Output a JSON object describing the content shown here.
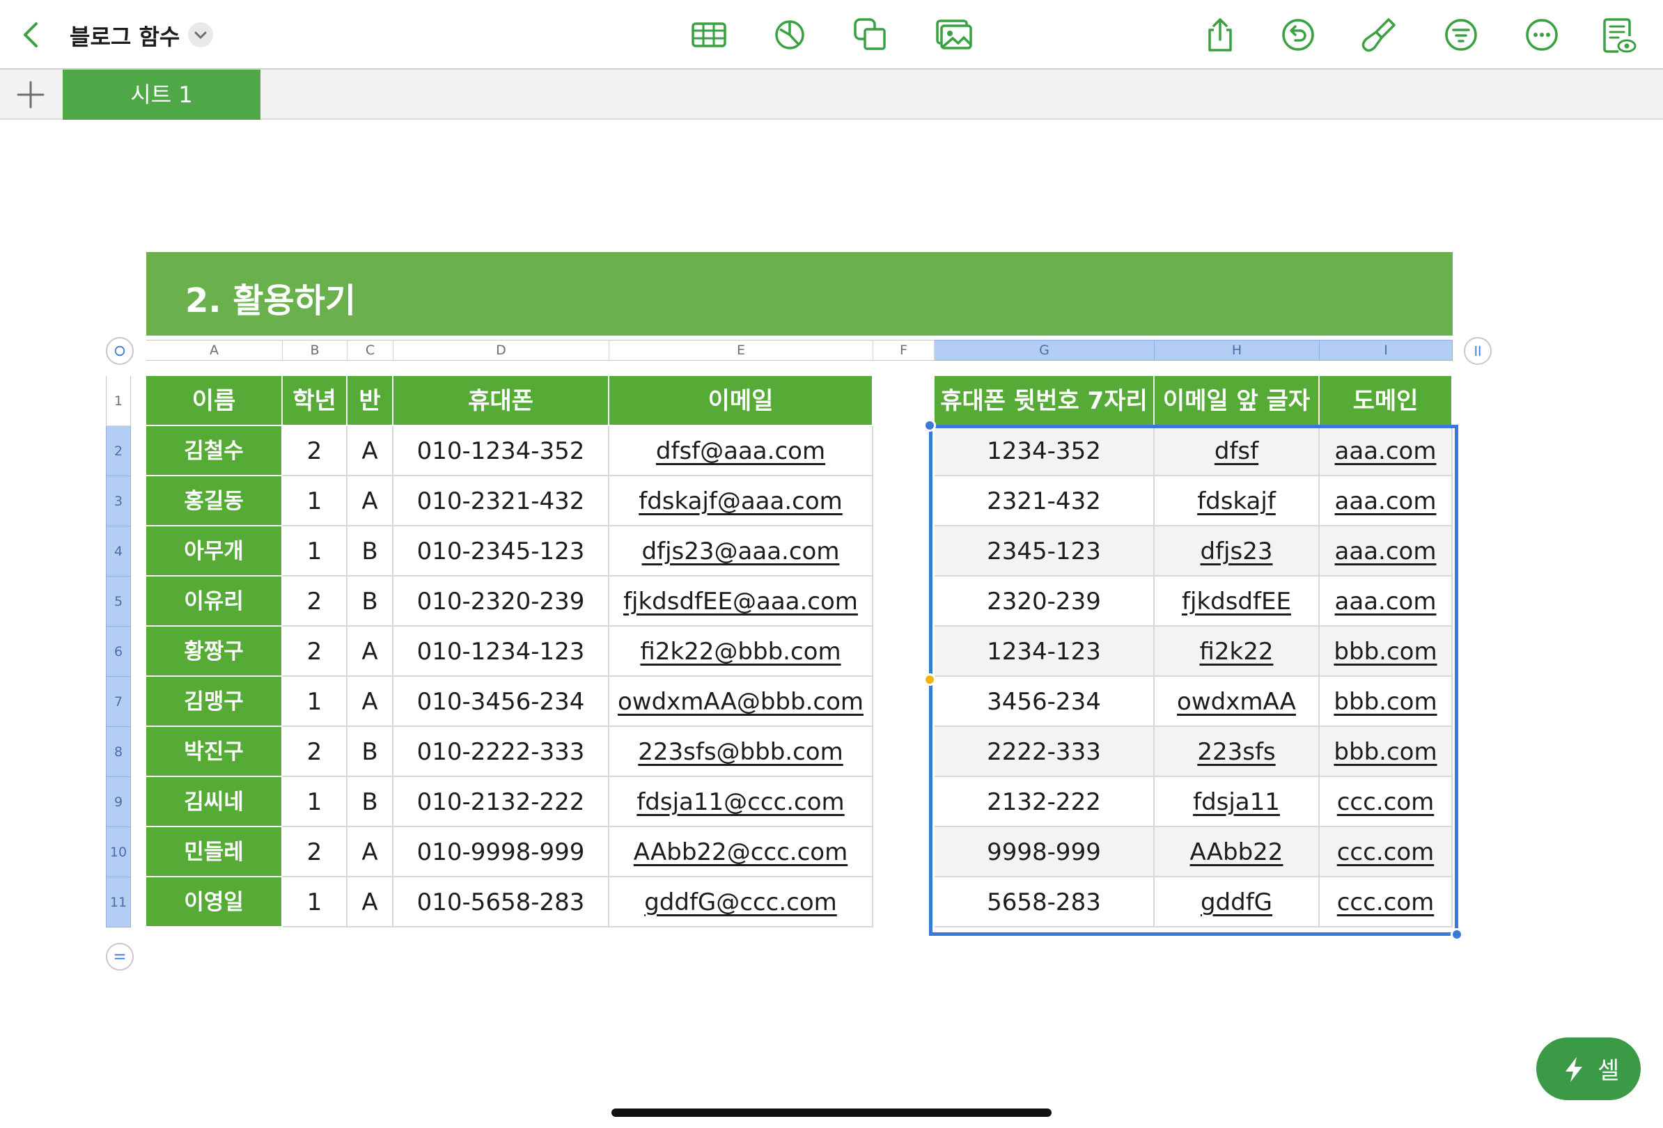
{
  "toolbar": {
    "title": "블로그 함수",
    "icons": [
      "back-chevron-icon",
      "table-icon",
      "chart-icon",
      "shapes-icon",
      "media-icon",
      "share-icon",
      "undo-icon",
      "format-brush-icon",
      "organize-icon",
      "more-icon",
      "document-view-icon"
    ]
  },
  "tabs": {
    "sheet1": "시트 1"
  },
  "table": {
    "title": "2. 활용하기",
    "columns": [
      "A",
      "B",
      "C",
      "D",
      "E",
      "F",
      "G",
      "H",
      "I"
    ],
    "headers": {
      "name": "이름",
      "grade": "학년",
      "class": "반",
      "phone": "휴대폰",
      "email": "이메일",
      "phone7": "휴대폰 뒷번호 7자리",
      "emailPrefix": "이메일 앞 글자",
      "domain": "도메인"
    },
    "rows": [
      {
        "num": "2",
        "name": "김철수",
        "grade": "2",
        "cls": "A",
        "phone": "010-1234-352",
        "email": "dfsf@aaa.com",
        "p7": "1234-352",
        "prefix": "dfsf",
        "domain": "aaa.com"
      },
      {
        "num": "3",
        "name": "홍길동",
        "grade": "1",
        "cls": "A",
        "phone": "010-2321-432",
        "email": "fdskajf@aaa.com",
        "p7": "2321-432",
        "prefix": "fdskajf",
        "domain": "aaa.com"
      },
      {
        "num": "4",
        "name": "아무개",
        "grade": "1",
        "cls": "B",
        "phone": "010-2345-123",
        "email": "dfjs23@aaa.com",
        "p7": "2345-123",
        "prefix": "dfjs23",
        "domain": "aaa.com"
      },
      {
        "num": "5",
        "name": "이유리",
        "grade": "2",
        "cls": "B",
        "phone": "010-2320-239",
        "email": "fjkdsdfEE@aaa.com",
        "p7": "2320-239",
        "prefix": "fjkdsdfEE",
        "domain": "aaa.com"
      },
      {
        "num": "6",
        "name": "황짱구",
        "grade": "2",
        "cls": "A",
        "phone": "010-1234-123",
        "email": "fi2k22@bbb.com",
        "p7": "1234-123",
        "prefix": "fi2k22",
        "domain": "bbb.com"
      },
      {
        "num": "7",
        "name": "김맹구",
        "grade": "1",
        "cls": "A",
        "phone": "010-3456-234",
        "email": "owdxmAA@bbb.com",
        "p7": "3456-234",
        "prefix": "owdxmAA",
        "domain": "bbb.com"
      },
      {
        "num": "8",
        "name": "박진구",
        "grade": "2",
        "cls": "B",
        "phone": "010-2222-333",
        "email": "223sfs@bbb.com",
        "p7": "2222-333",
        "prefix": "223sfs",
        "domain": "bbb.com"
      },
      {
        "num": "9",
        "name": "김씨네",
        "grade": "1",
        "cls": "B",
        "phone": "010-2132-222",
        "email": "fdsja11@ccc.com",
        "p7": "2132-222",
        "prefix": "fdsja11",
        "domain": "ccc.com"
      },
      {
        "num": "10",
        "name": "민들레",
        "grade": "2",
        "cls": "A",
        "phone": "010-9998-999",
        "email": "AAbb22@ccc.com",
        "p7": "9998-999",
        "prefix": "AAbb22",
        "domain": "ccc.com"
      },
      {
        "num": "11",
        "name": "이영일",
        "grade": "1",
        "cls": "A",
        "phone": "010-5658-283",
        "email": "gddfG@ccc.com",
        "p7": "5658-283",
        "prefix": "gddfG",
        "domain": "ccc.com"
      }
    ]
  },
  "fab": {
    "label": "셀"
  },
  "colors": {
    "accent": "#55ab36",
    "title": "#6ab04c",
    "selection": "#3a78d9",
    "fab": "#3a9a45"
  }
}
